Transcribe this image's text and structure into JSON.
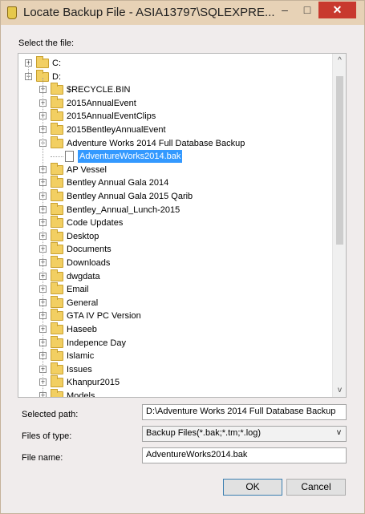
{
  "window": {
    "title": "Locate Backup File - ASIA13797\\SQLEXPRE...",
    "minimize_label": "–",
    "maximize_label": "□",
    "close_label": "✕"
  },
  "select_label": "Select the file:",
  "tree": {
    "drives": [
      {
        "label": "C:",
        "expanded": false
      },
      {
        "label": "D:",
        "expanded": true
      }
    ],
    "d_children": [
      {
        "label": "$RECYCLE.BIN"
      },
      {
        "label": "2015AnnualEvent"
      },
      {
        "label": "2015AnnualEventClips"
      },
      {
        "label": "2015BentleyAnnualEvent"
      },
      {
        "label": "Adventure Works 2014 Full Database Backup",
        "expanded": true
      },
      {
        "label": "AP Vessel"
      },
      {
        "label": "Bentley Annual Gala 2014"
      },
      {
        "label": "Bentley Annual Gala 2015 Qarib"
      },
      {
        "label": "Bentley_Annual_Lunch-2015"
      },
      {
        "label": "Code Updates"
      },
      {
        "label": "Desktop"
      },
      {
        "label": "Documents"
      },
      {
        "label": "Downloads"
      },
      {
        "label": "dwgdata"
      },
      {
        "label": "Email"
      },
      {
        "label": "General"
      },
      {
        "label": "GTA IV PC Version"
      },
      {
        "label": "Haseeb"
      },
      {
        "label": "Indepence Day"
      },
      {
        "label": "Islamic"
      },
      {
        "label": "Issues"
      },
      {
        "label": "Khanpur2015"
      },
      {
        "label": "Models"
      }
    ],
    "selected_file": "AdventureWorks2014.bak"
  },
  "form": {
    "selected_path_label": "Selected path:",
    "selected_path_value": "D:\\Adventure Works 2014 Full Database Backup",
    "files_of_type_label": "Files of type:",
    "files_of_type_value": "Backup Files(*.bak;*.tm;*.log)",
    "file_name_label": "File name:",
    "file_name_value": "AdventureWorks2014.bak"
  },
  "buttons": {
    "ok": "OK",
    "cancel": "Cancel"
  },
  "icons": {
    "app": "database-icon",
    "folder": "folder-icon",
    "file": "file-icon",
    "scroll_up": "chevron-up-icon",
    "scroll_down": "chevron-down-icon",
    "dropdown": "chevron-down-icon"
  }
}
